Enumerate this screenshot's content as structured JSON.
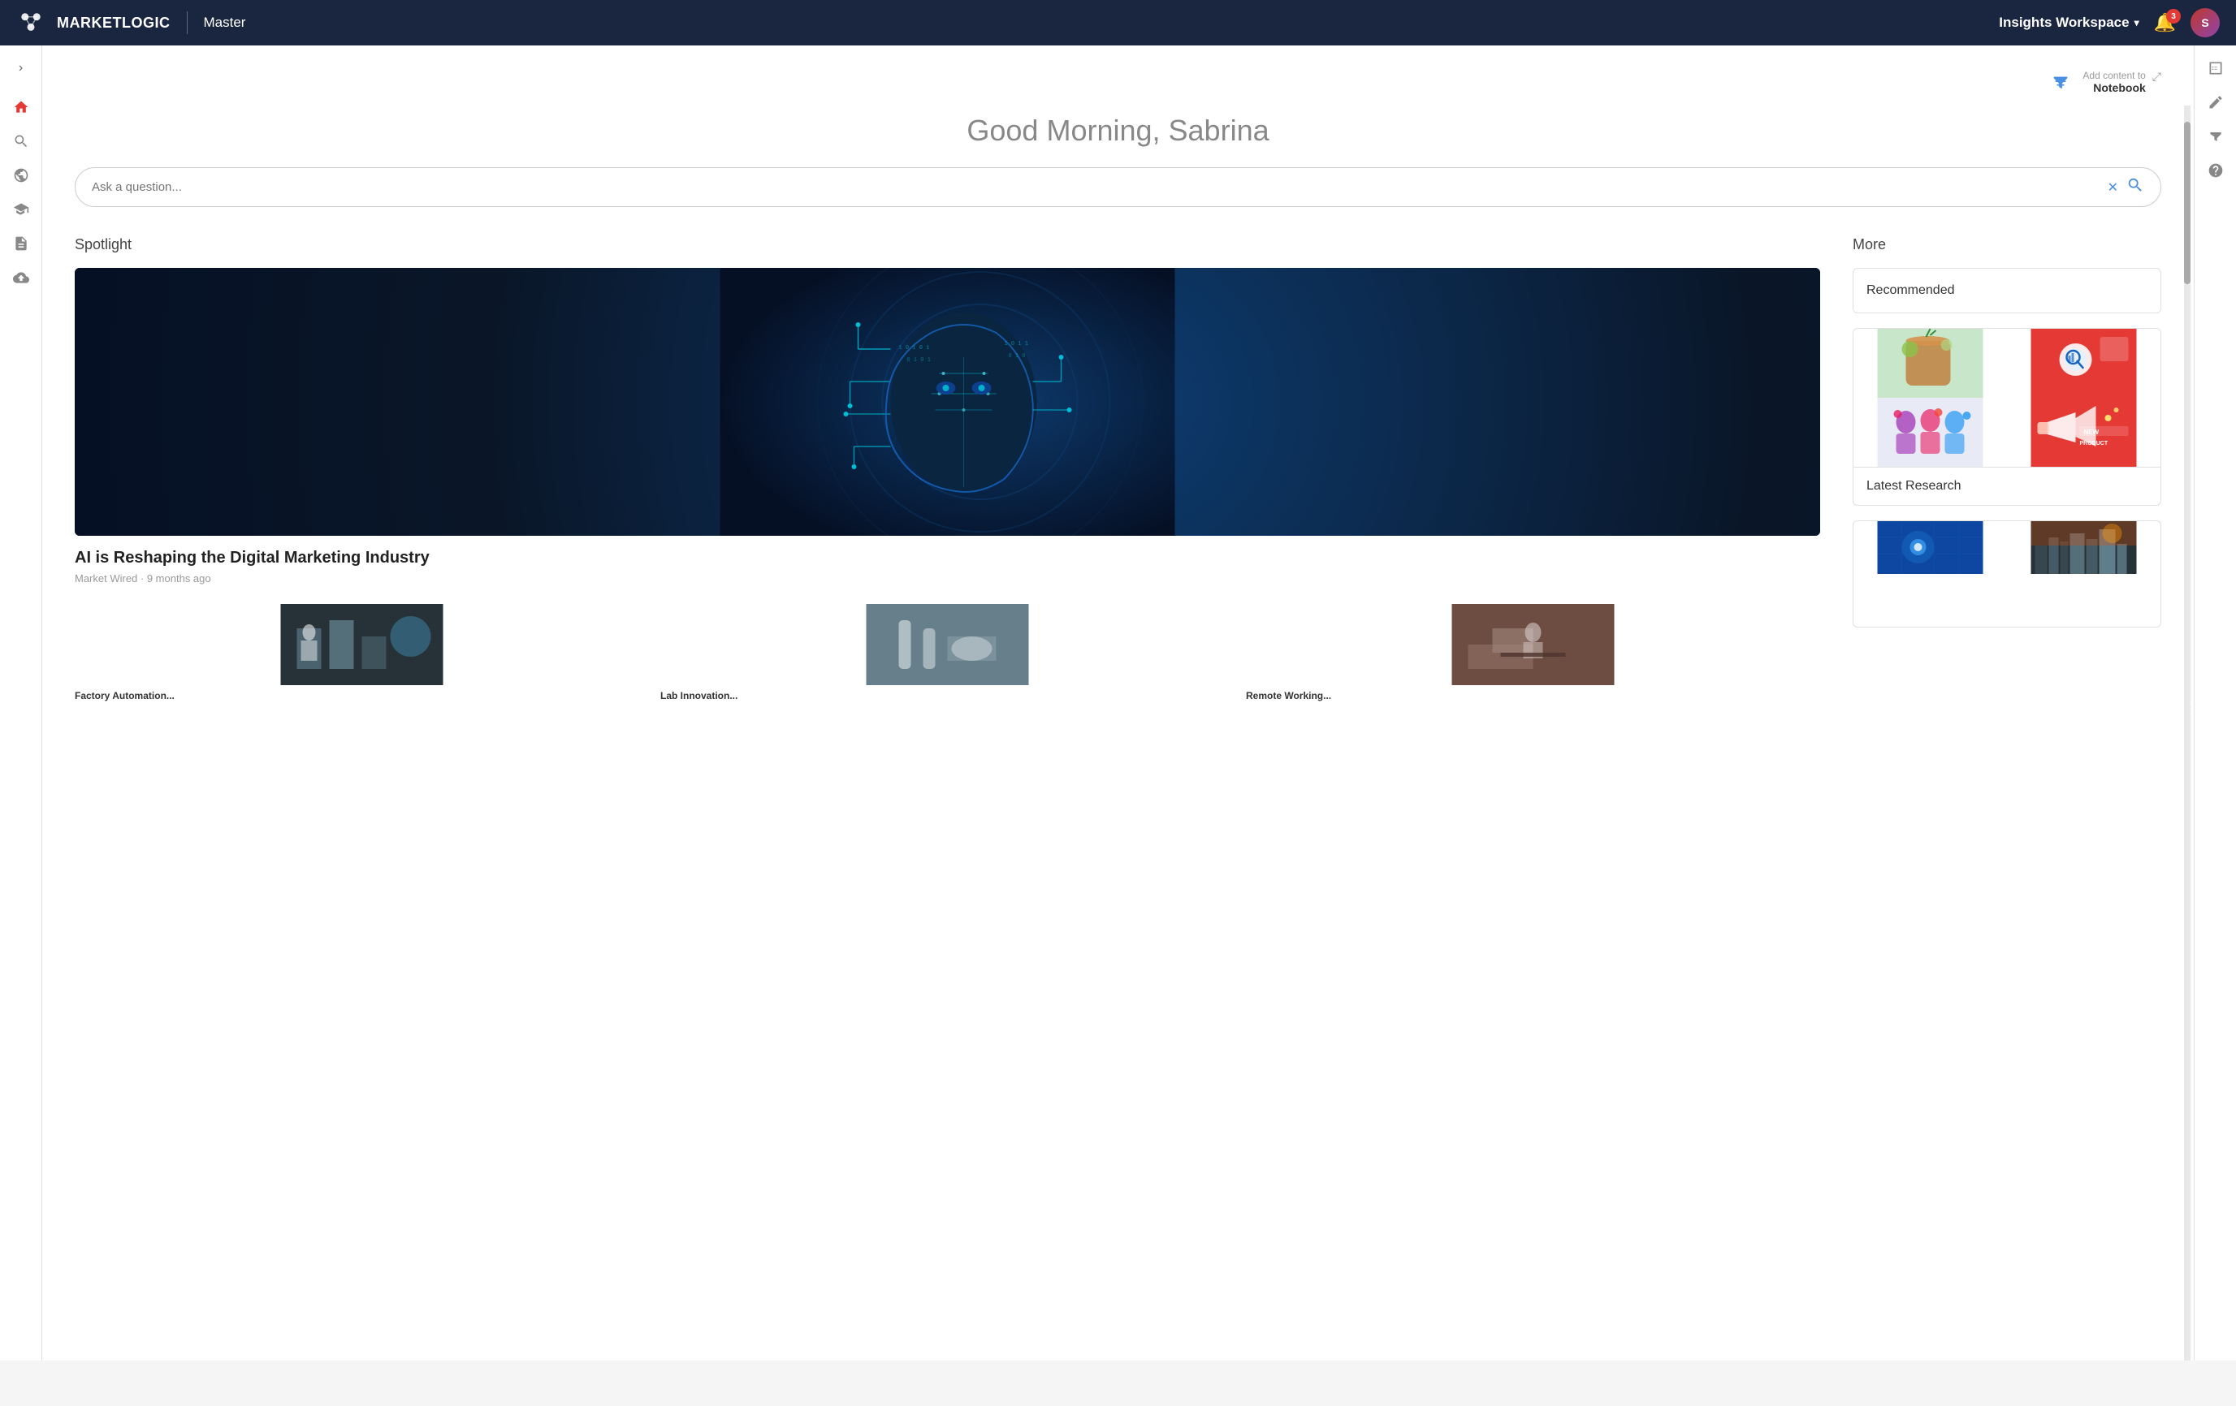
{
  "topnav": {
    "logo_text": "MARKETLOGIC",
    "divider": "|",
    "master_label": "Master",
    "workspace_label": "Insights Workspace",
    "notif_count": "3",
    "avatar_initials": "S"
  },
  "sidebar": {
    "toggle_label": "›",
    "items": [
      {
        "icon": "home",
        "label": "Home",
        "active": true
      },
      {
        "icon": "search",
        "label": "Search",
        "active": false
      },
      {
        "icon": "globe",
        "label": "Globe",
        "active": false
      },
      {
        "icon": "graduation",
        "label": "Learning",
        "active": false
      },
      {
        "icon": "document",
        "label": "Documents",
        "active": false
      },
      {
        "icon": "upload",
        "label": "Upload",
        "active": false
      }
    ]
  },
  "subheader": {
    "filter_icon": "≡",
    "notebook_add": "Add content to",
    "notebook_label": "Notebook",
    "expand_icon": "⤢"
  },
  "main": {
    "greeting": "Good Morning, Sabrina",
    "search_placeholder": "Ask a question...",
    "spotlight_title": "Spotlight",
    "article_title": "AI is Reshaping the Digital Marketing Industry",
    "article_meta": "Market Wired · 9 months ago",
    "more_title": "More",
    "recommended_label": "Recommended",
    "latest_research_label": "Latest Research",
    "thumbnails": [
      {
        "title": "Factory Automation...",
        "bg": "blue-tech"
      },
      {
        "title": "Lab Innovation...",
        "bg": "lab"
      },
      {
        "title": "Remote Working...",
        "bg": "cafe"
      }
    ]
  },
  "right_panel": {
    "items": [
      {
        "icon": "table",
        "label": "Table view"
      },
      {
        "icon": "edit",
        "label": "Edit"
      },
      {
        "icon": "filter",
        "label": "Filter"
      },
      {
        "icon": "help",
        "label": "Help"
      }
    ]
  }
}
